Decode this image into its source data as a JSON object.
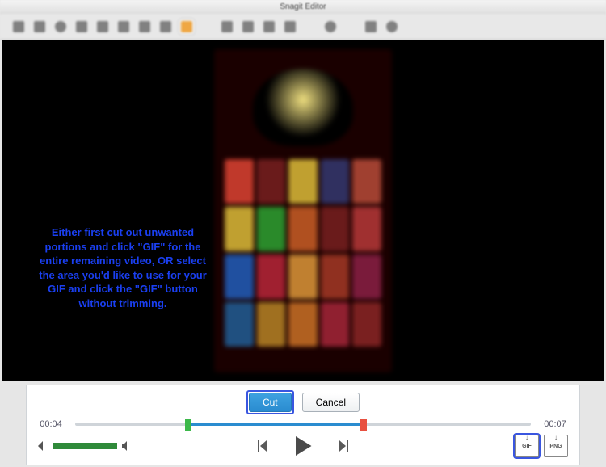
{
  "window": {
    "title": "Snagit Editor"
  },
  "toolbar": {
    "items": [
      "Draw",
      "Highlight",
      "Select",
      "Pen",
      "Line",
      "Arrow",
      "Cursor",
      "Trim",
      "Sequence",
      "Sep",
      "View",
      "Selection",
      "Toolbar2Page",
      "More",
      "Misc",
      "Blur",
      "Gear"
    ]
  },
  "preview": {
    "symbols": [
      "#c0392b",
      "#6a1b1b",
      "#c0a030",
      "#303060",
      "#a04030",
      "#c0a030",
      "#2a8a2a",
      "#b05020",
      "#6a1b1b",
      "#a03030",
      "#2050a0",
      "#a02030",
      "#c08030",
      "#903020",
      "#7a1b3b",
      "#205080",
      "#a07020",
      "#b06020",
      "#902030",
      "#7a2020"
    ]
  },
  "instruction": {
    "text": "Either first cut out unwanted portions and click \"GIF\" for the entire remaining video, OR select the area you'd like to use for your GIF and click the \"GIF\" button without trimming."
  },
  "controls": {
    "cut_label": "Cut",
    "cancel_label": "Cancel",
    "time_start": "00:04",
    "time_end": "00:07",
    "export_gif": "GIF",
    "export_png": "PNG"
  }
}
